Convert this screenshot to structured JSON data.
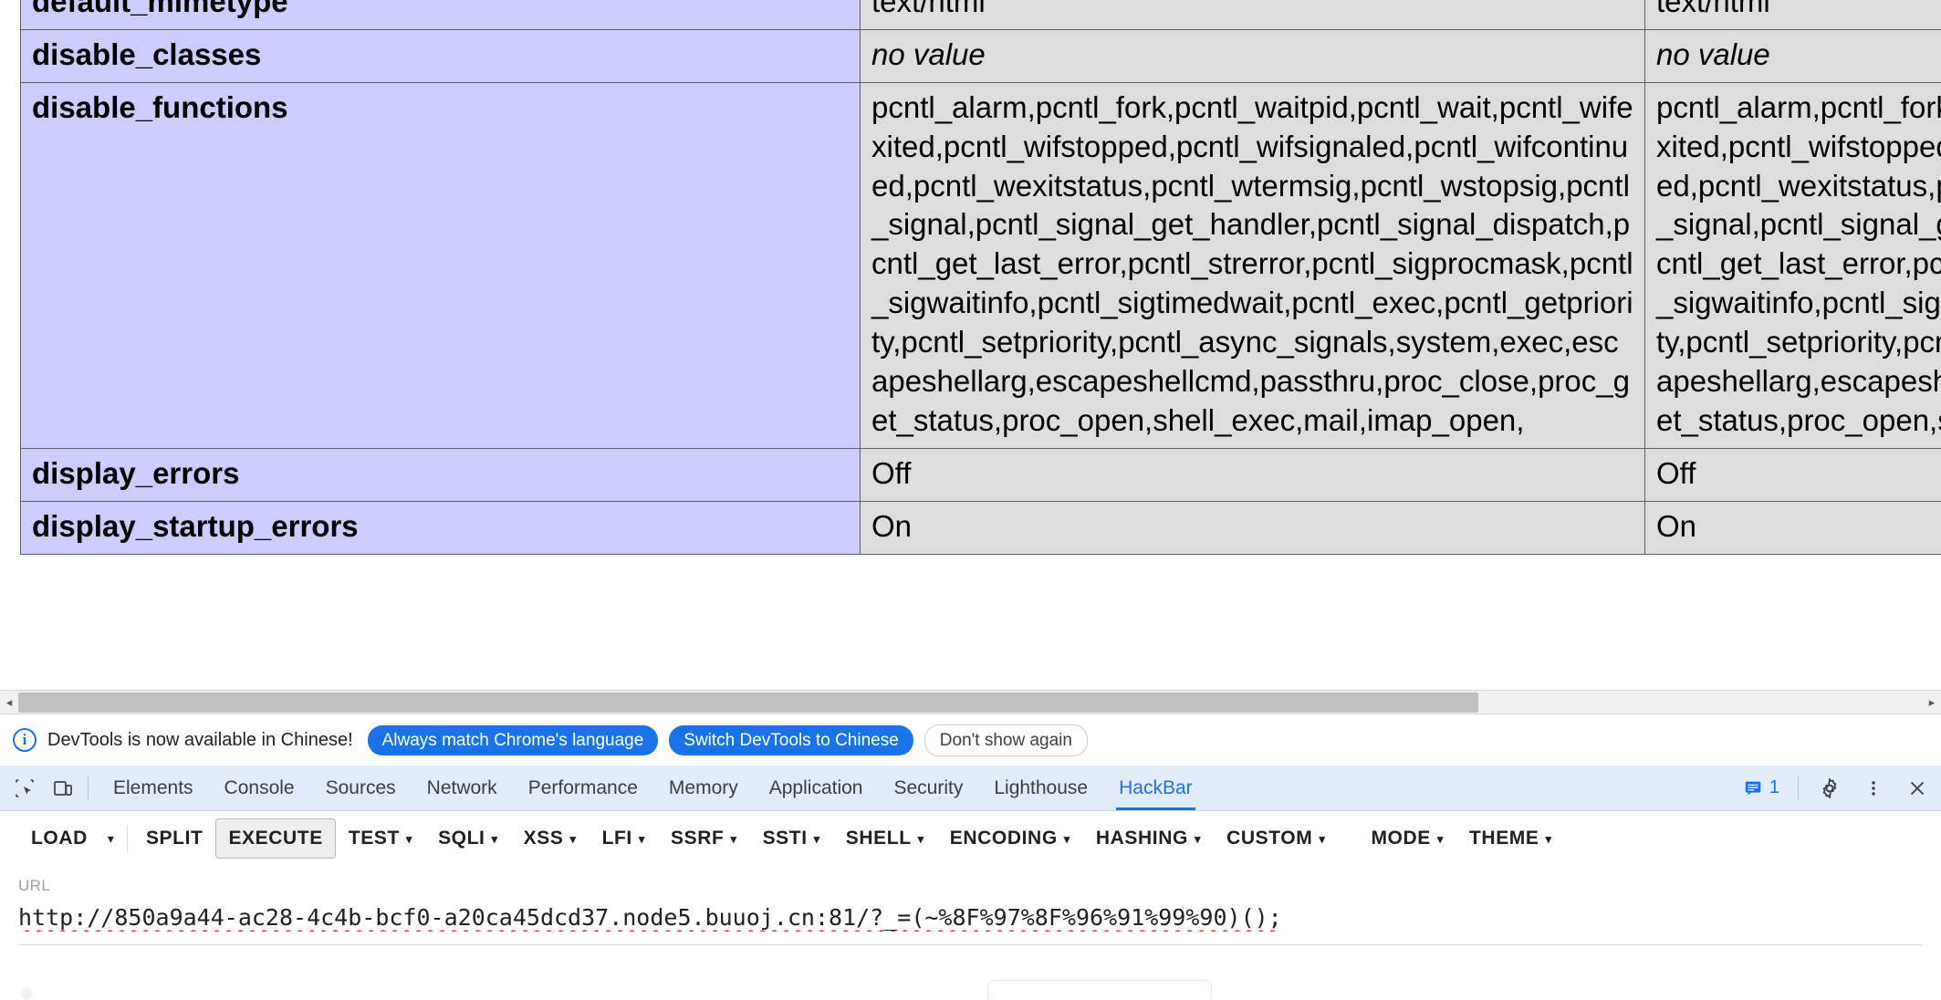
{
  "page": {
    "table": {
      "rows": [
        {
          "directive": "default_mimetype",
          "local_value": "text/html",
          "master_value": "text/html",
          "local_is_novalue": false,
          "master_is_novalue": false
        },
        {
          "directive": "disable_classes",
          "local_value": "no value",
          "master_value": "no value",
          "local_is_novalue": true,
          "master_is_novalue": true
        },
        {
          "directive": "disable_functions",
          "local_value": "pcntl_alarm,pcntl_fork,pcntl_waitpid,pcntl_wait,pcntl_wifexited,pcntl_wifstopped,pcntl_wifsignaled,pcntl_wifcontinued,pcntl_wexitstatus,pcntl_wtermsig,pcntl_wstopsig,pcntl_signal,pcntl_signal_get_handler,pcntl_signal_dispatch,pcntl_get_last_error,pcntl_strerror,pcntl_sigprocmask,pcntl_sigwaitinfo,pcntl_sigtimedwait,pcntl_exec,pcntl_getpriority,pcntl_setpriority,pcntl_async_signals,system,exec,escapeshellarg,escapeshellcmd,passthru,proc_close,proc_get_status,proc_open,shell_exec,mail,imap_open,",
          "master_value": "pcntl_alarm,pcntl_fork,pcntl_waitpid,pcntl_wait,pcntl_wifexited,pcntl_wifstopped,pcntl_wifsignaled,pcntl_wifcontinued,pcntl_wexitstatus,pcntl_wtermsig,pcntl_wstopsig,pcntl_signal,pcntl_signal_get_handler,pcntl_signal_dispatch,pcntl_get_last_error,pcntl_strerror,pcntl_sigprocmask,pcntl_sigwaitinfo,pcntl_sigtimedwait,pcntl_exec,pcntl_getpriority,pcntl_setpriority,pcntl_async_signals,system,exec,escapeshellarg,escapeshellcmd,passthru,proc_close,proc_get_status,proc_open,shell_exec,mail,imap_open,",
          "local_is_novalue": false,
          "master_is_novalue": false
        },
        {
          "directive": "display_errors",
          "local_value": "Off",
          "master_value": "Off",
          "local_is_novalue": false,
          "master_is_novalue": false
        },
        {
          "directive": "display_startup_errors",
          "local_value": "On",
          "master_value": "On",
          "local_is_novalue": false,
          "master_is_novalue": false
        }
      ]
    },
    "scrollbar": {
      "left_arrow": "◂",
      "right_arrow": "▸"
    },
    "colors": {
      "key_cell_bg": "#ccccff",
      "value_cell_bg": "#dddddd",
      "border": "#606060"
    }
  },
  "devtools": {
    "banner": {
      "info_icon": "info-icon",
      "message": "DevTools is now available in Chinese!",
      "primary_button": "Always match Chrome's language",
      "secondary_button": "Switch DevTools to Chinese",
      "dismiss_button": "Don't show again",
      "accent_color": "#1a73e8"
    },
    "tabs": {
      "inspect_icon": "inspect-element-icon",
      "device_icon": "device-toolbar-icon",
      "items": [
        {
          "label": "Elements",
          "active": false
        },
        {
          "label": "Console",
          "active": false
        },
        {
          "label": "Sources",
          "active": false
        },
        {
          "label": "Network",
          "active": false
        },
        {
          "label": "Performance",
          "active": false
        },
        {
          "label": "Memory",
          "active": false
        },
        {
          "label": "Application",
          "active": false
        },
        {
          "label": "Security",
          "active": false
        },
        {
          "label": "Lighthouse",
          "active": false
        },
        {
          "label": "HackBar",
          "active": true
        }
      ],
      "message_count": "1",
      "message_icon": "console-message-icon",
      "settings_icon": "gear-icon",
      "more_icon": "kebab-menu-icon",
      "close_icon": "close-icon"
    }
  },
  "hackbar": {
    "toolbar": [
      {
        "label": "LOAD",
        "caret": false,
        "framed": false,
        "split_caret": true
      },
      {
        "label": "SPLIT",
        "caret": false,
        "framed": false
      },
      {
        "label": "EXECUTE",
        "caret": false,
        "framed": true
      },
      {
        "label": "TEST",
        "caret": true,
        "framed": false
      },
      {
        "label": "SQLI",
        "caret": true,
        "framed": false
      },
      {
        "label": "XSS",
        "caret": true,
        "framed": false
      },
      {
        "label": "LFI",
        "caret": true,
        "framed": false
      },
      {
        "label": "SSRF",
        "caret": true,
        "framed": false
      },
      {
        "label": "SSTI",
        "caret": true,
        "framed": false
      },
      {
        "label": "SHELL",
        "caret": true,
        "framed": false
      },
      {
        "label": "ENCODING",
        "caret": true,
        "framed": false
      },
      {
        "label": "HASHING",
        "caret": true,
        "framed": false
      },
      {
        "label": "CUSTOM",
        "caret": true,
        "framed": false
      },
      {
        "label": "MODE",
        "caret": true,
        "framed": false
      },
      {
        "label": "THEME",
        "caret": true,
        "framed": false
      }
    ],
    "caret_glyph": "▾",
    "url": {
      "label": "URL",
      "value": "http://850a9a44-ac28-4c4b-bcf0-a20ca45dcd37.node5.buuoj.cn:81/?_=(~%8F%97%8F%96%91%99%90)();",
      "placeholder": "URL"
    }
  }
}
